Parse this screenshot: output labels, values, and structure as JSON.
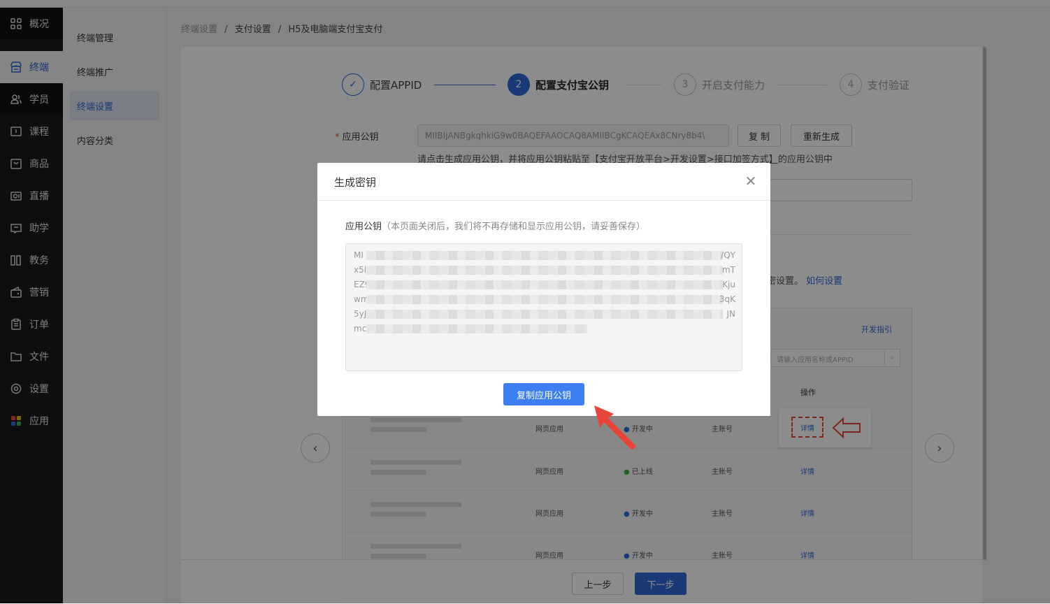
{
  "sidenav": {
    "items": [
      {
        "label": "概况",
        "icon": "grid-icon"
      },
      {
        "label": "终端",
        "icon": "store-icon"
      },
      {
        "label": "学员",
        "icon": "users-icon"
      },
      {
        "label": "课程",
        "icon": "course-icon"
      },
      {
        "label": "商品",
        "icon": "bag-icon"
      },
      {
        "label": "直播",
        "icon": "live-icon"
      },
      {
        "label": "助学",
        "icon": "assist-icon"
      },
      {
        "label": "教务",
        "icon": "books-icon"
      },
      {
        "label": "营销",
        "icon": "wallet-icon"
      },
      {
        "label": "订单",
        "icon": "order-icon"
      },
      {
        "label": "文件",
        "icon": "folder-icon"
      },
      {
        "label": "设置",
        "icon": "gear-icon"
      },
      {
        "label": "应用",
        "icon": "apps-icon"
      }
    ],
    "active": "终端"
  },
  "submenu": {
    "items": [
      "终端管理",
      "终端推广",
      "终端设置",
      "内容分类"
    ],
    "active": "终端设置"
  },
  "breadcrumb": {
    "items": [
      "终端设置",
      "支付设置",
      "H5及电脑端支付宝支付"
    ],
    "separator": "/"
  },
  "steps": [
    {
      "num": "✓",
      "label": "配置APPID",
      "state": "done"
    },
    {
      "num": "2",
      "label": "配置支付宝公钥",
      "state": "current"
    },
    {
      "num": "3",
      "label": "开启支付能力",
      "state": "todo"
    },
    {
      "num": "4",
      "label": "支付验证",
      "state": "todo"
    }
  ],
  "form": {
    "app_key_label": "应用公钥",
    "app_key_value": "MIIBIjANBgkqhkiG9w0BAQEFAAOCAQ8AMIIBCgKCAQEAx8CNry8b4\\",
    "copy_label": "复 制",
    "regenerate_label": "重新生成",
    "hint_prefix": "请点击生成应用公钥，并将应用公钥粘贴至",
    "hint_path": "【支付宝开放平台>开发设置>接口加签方式】",
    "hint_suffix": "的应用公钥中",
    "help_text_suffix": "密设置。",
    "help_link": "如何设置"
  },
  "illustration": {
    "dev_guide": "开发指引",
    "search_placeholder": "请输入应用名称或APPID",
    "col_op": "操作",
    "detail": "详情",
    "rows": [
      {
        "type": "网页应用",
        "status": "开发中",
        "status_color": "#2e6bd8",
        "account": "主账号"
      },
      {
        "type": "网页应用",
        "status": "已上线",
        "status_color": "#3bb54a",
        "account": "主账号"
      },
      {
        "type": "网页应用",
        "status": "开发中",
        "status_color": "#2e6bd8",
        "account": "主账号"
      },
      {
        "type": "网页应用",
        "status": "开发中",
        "status_color": "#2e6bd8",
        "account": "主账号"
      }
    ]
  },
  "footer": {
    "prev_label": "上一步",
    "next_label": "下一步"
  },
  "modal": {
    "title": "生成密钥",
    "field_label": "应用公钥",
    "field_note": "（本页面关闭后，我们将不再存储和显示应用公钥，请妥善保存）",
    "key_lines": [
      {
        "prefix": "MI",
        "suffix": "/QY"
      },
      {
        "prefix": "x5l",
        "suffix": "mT"
      },
      {
        "prefix": "EZ9",
        "suffix": "Kju"
      },
      {
        "prefix": "wm",
        "suffix": "3qK"
      },
      {
        "prefix": "5yJ",
        "suffix": "JN"
      },
      {
        "prefix": "mc",
        "suffix": ""
      }
    ],
    "copy_button": "复制应用公钥"
  },
  "colors": {
    "accent": "#2e6bd8",
    "modal_button": "#3d7ef0",
    "sidenav_bg": "#1a1a1f",
    "annotation_red": "#e8463a"
  }
}
